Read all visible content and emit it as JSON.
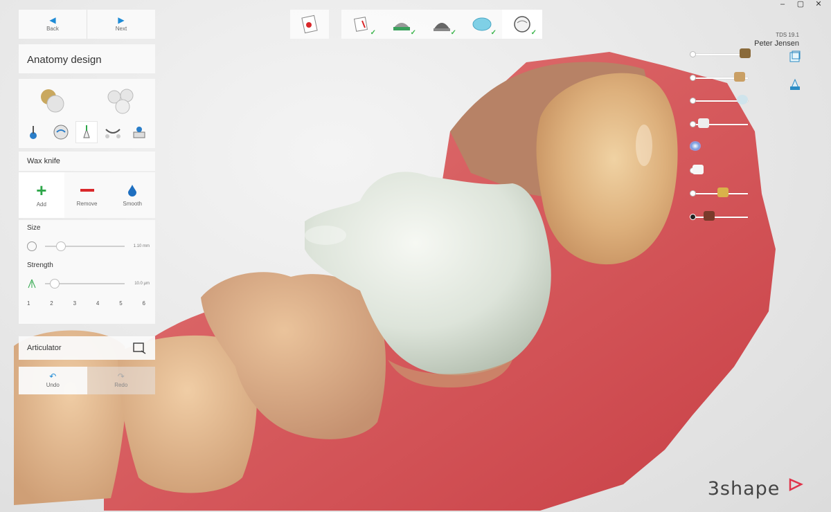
{
  "window_controls": [
    "–",
    "▢",
    "✕"
  ],
  "nav": {
    "back_label": "Back",
    "next_label": "Next"
  },
  "panel": {
    "title": "Anatomy design",
    "tool_section": "Wax knife",
    "modes": [
      {
        "label": "Add",
        "icon": "plus-icon",
        "active": true
      },
      {
        "label": "Remove",
        "icon": "minus-icon",
        "active": false
      },
      {
        "label": "Smooth",
        "icon": "drop-icon",
        "active": false
      }
    ],
    "size": {
      "label": "Size",
      "value_text": "1.10 mm",
      "level": 0.2
    },
    "strength": {
      "label": "Strength",
      "value_text": "10.0 μm",
      "level": 0.12
    },
    "number_keys": [
      "1",
      "2",
      "3",
      "4",
      "5",
      "6"
    ],
    "articulator_label": "Articulator",
    "undo_label": "Undo",
    "redo_label": "Redo"
  },
  "user": {
    "version": "TDS 19.1",
    "name": "Peter Jensen"
  },
  "visibility_levels": [
    0.95,
    0.85,
    0.9,
    0.2,
    0.05,
    0.1,
    0.55,
    0.3
  ],
  "logo": "3shape",
  "colors": {
    "accent": "#1e8bd6",
    "add": "#2ea64a",
    "remove": "#d9282b",
    "gum": "#d9595a",
    "crown": "#dfe5dc",
    "tooth": "#d9a77a"
  }
}
